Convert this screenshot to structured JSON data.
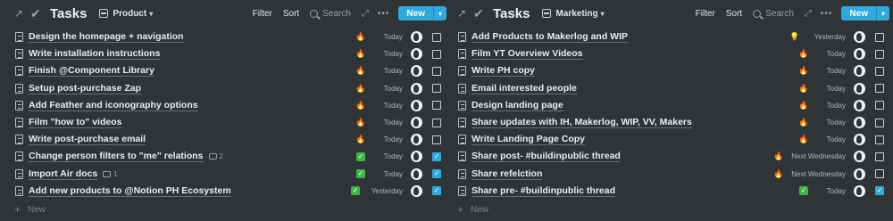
{
  "left": {
    "title": "Tasks",
    "view": "Product",
    "toolbar": {
      "filter": "Filter",
      "sort": "Sort",
      "search": "Search",
      "new": "New"
    },
    "new_row": "New",
    "rows": [
      {
        "title": "Design the homepage + navigation",
        "priority": "fire",
        "due": "Today",
        "done": false
      },
      {
        "title": "Write installation instructions",
        "priority": "fire",
        "due": "Today",
        "done": false
      },
      {
        "title": "Finish @Component Library",
        "priority": "fire",
        "due": "Today",
        "done": false
      },
      {
        "title": "Setup post-purchase Zap",
        "priority": "fire",
        "due": "Today",
        "done": false
      },
      {
        "title": "Add Feather and iconography options",
        "priority": "fire",
        "due": "Today",
        "done": false
      },
      {
        "title": "Film \"how to\" videos",
        "priority": "fire",
        "due": "Today",
        "done": false
      },
      {
        "title": "Write post-purchase email",
        "priority": "fire",
        "due": "Today",
        "done": false
      },
      {
        "title": "Change person filters to \"me\" relations",
        "comments": "2",
        "priority": "check",
        "due": "Today",
        "done": true
      },
      {
        "title": "Import Air docs",
        "comments": "1",
        "priority": "check",
        "due": "Today",
        "done": true
      },
      {
        "title": "Add new products to @Notion PH Ecosystem",
        "priority": "check",
        "due": "Yesterday",
        "done": true
      }
    ]
  },
  "right": {
    "title": "Tasks",
    "view": "Marketing",
    "toolbar": {
      "filter": "Filter",
      "sort": "Sort",
      "search": "Search",
      "new": "New"
    },
    "new_row": "New",
    "rows": [
      {
        "title": "Add Products to Makerlog and WIP",
        "priority": "bulb",
        "due": "Yesterday",
        "done": false
      },
      {
        "title": "Film YT Overview Videos",
        "priority": "fire",
        "due": "Today",
        "done": false
      },
      {
        "title": "Write PH copy",
        "priority": "fire",
        "due": "Today",
        "done": false
      },
      {
        "title": "Email interested people",
        "priority": "fire",
        "due": "Today",
        "done": false
      },
      {
        "title": "Design landing page",
        "priority": "fire",
        "due": "Today",
        "done": false
      },
      {
        "title": "Share updates with IH, Makerlog, WIP, VV, Makers",
        "priority": "fire",
        "due": "Today",
        "done": false
      },
      {
        "title": "Write Landing Page Copy",
        "priority": "fire",
        "due": "Today",
        "done": false
      },
      {
        "title": "Share post- #buildinpublic thread",
        "priority": "fire",
        "due": "Next Wednesday",
        "done": false
      },
      {
        "title": "Share refelction",
        "priority": "fire",
        "due": "Next Wednesday",
        "done": false
      },
      {
        "title": "Share pre- #buildinpublic thread",
        "priority": "check",
        "due": "Today",
        "done": true
      }
    ]
  },
  "icons": {
    "fire": "🔥",
    "bulb": "💡",
    "check": "✓"
  },
  "colors": {
    "background": "#2f3437",
    "accent": "#2eaadc",
    "green_check": "#3db843"
  }
}
